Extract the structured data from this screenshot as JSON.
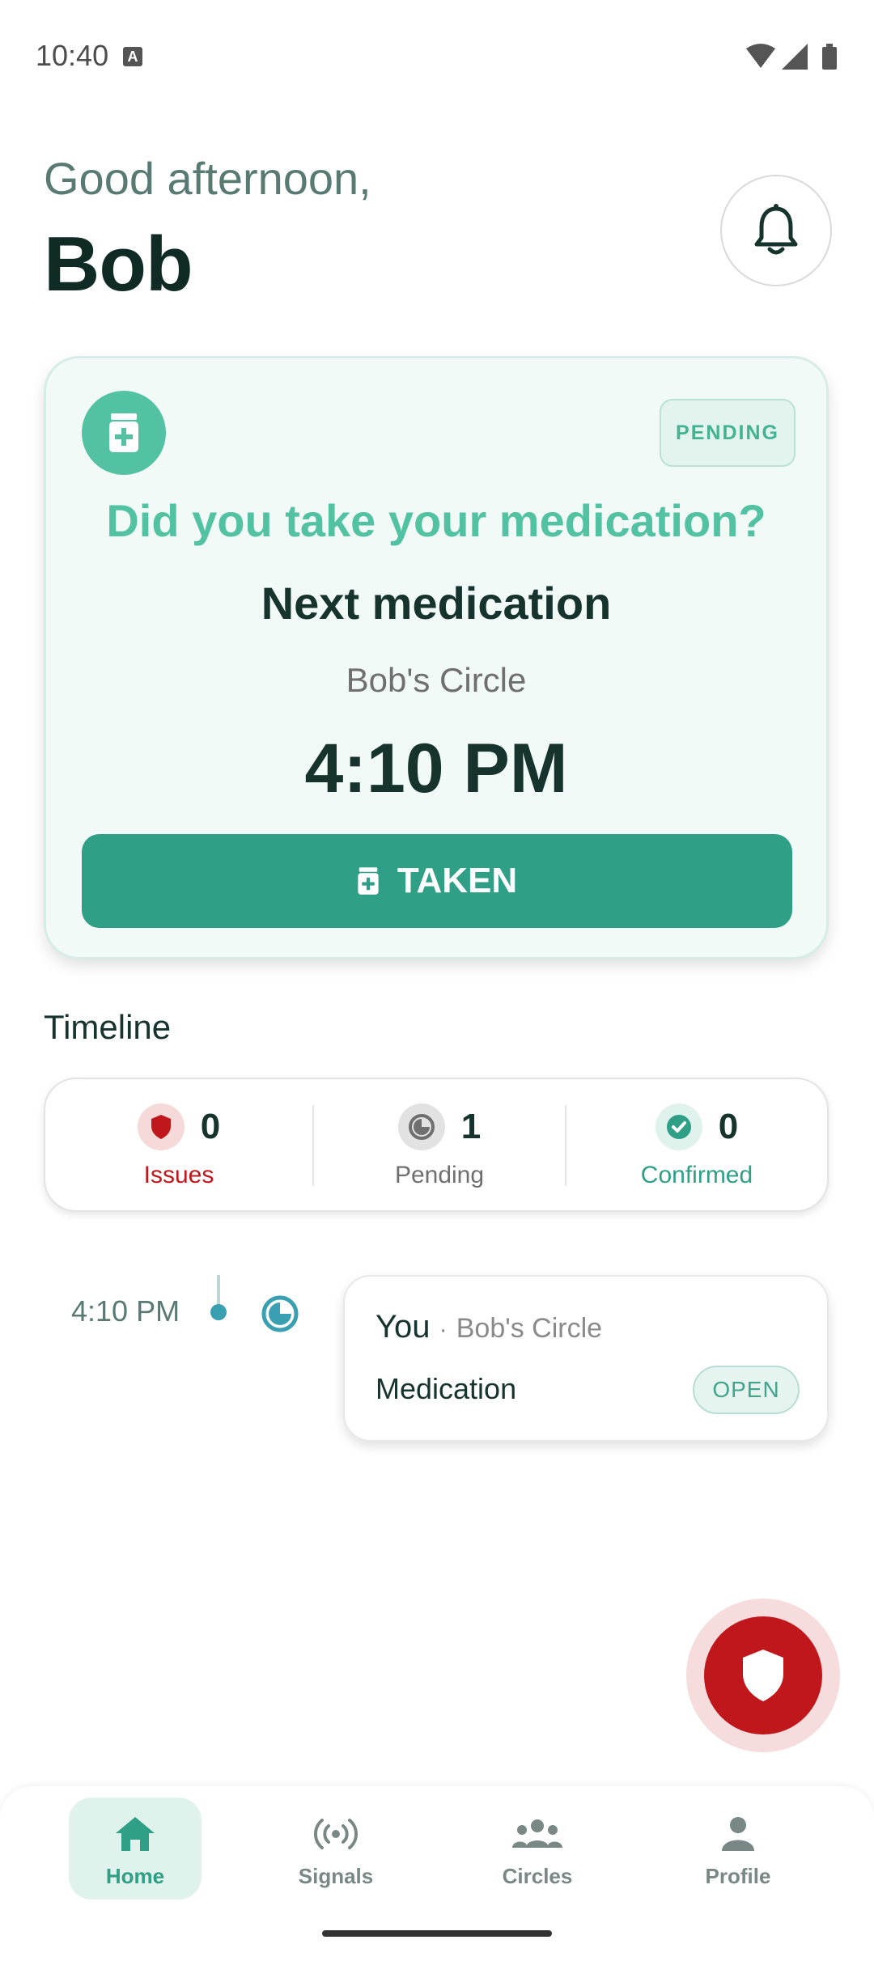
{
  "status_bar": {
    "time": "10:40",
    "indicator": "A"
  },
  "header": {
    "greeting": "Good afternoon,",
    "name": "Bob"
  },
  "med_card": {
    "badge": "PENDING",
    "question": "Did you take your medication?",
    "title": "Next medication",
    "circle": "Bob's Circle",
    "time": "4:10 PM",
    "action_label": "TAKEN"
  },
  "timeline": {
    "heading": "Timeline",
    "stats": [
      {
        "count": "0",
        "label": "Issues",
        "color": "#c0171c"
      },
      {
        "count": "1",
        "label": "Pending",
        "color": "#6f6f6f"
      },
      {
        "count": "0",
        "label": "Confirmed",
        "color": "#2f9f86"
      }
    ],
    "entries": [
      {
        "time": "4:10 PM",
        "who": "You",
        "separator": "·",
        "circle": "Bob's Circle",
        "type": "Medication",
        "status": "OPEN"
      }
    ]
  },
  "nav": {
    "items": [
      {
        "label": "Home",
        "icon": "home-icon",
        "active": true
      },
      {
        "label": "Signals",
        "icon": "signals-icon"
      },
      {
        "label": "Circles",
        "icon": "circles-icon"
      },
      {
        "label": "Profile",
        "icon": "profile-icon"
      }
    ]
  },
  "colors": {
    "accent": "#2f9f86",
    "accent_light": "#52c2a2",
    "alert": "#c0171c"
  }
}
